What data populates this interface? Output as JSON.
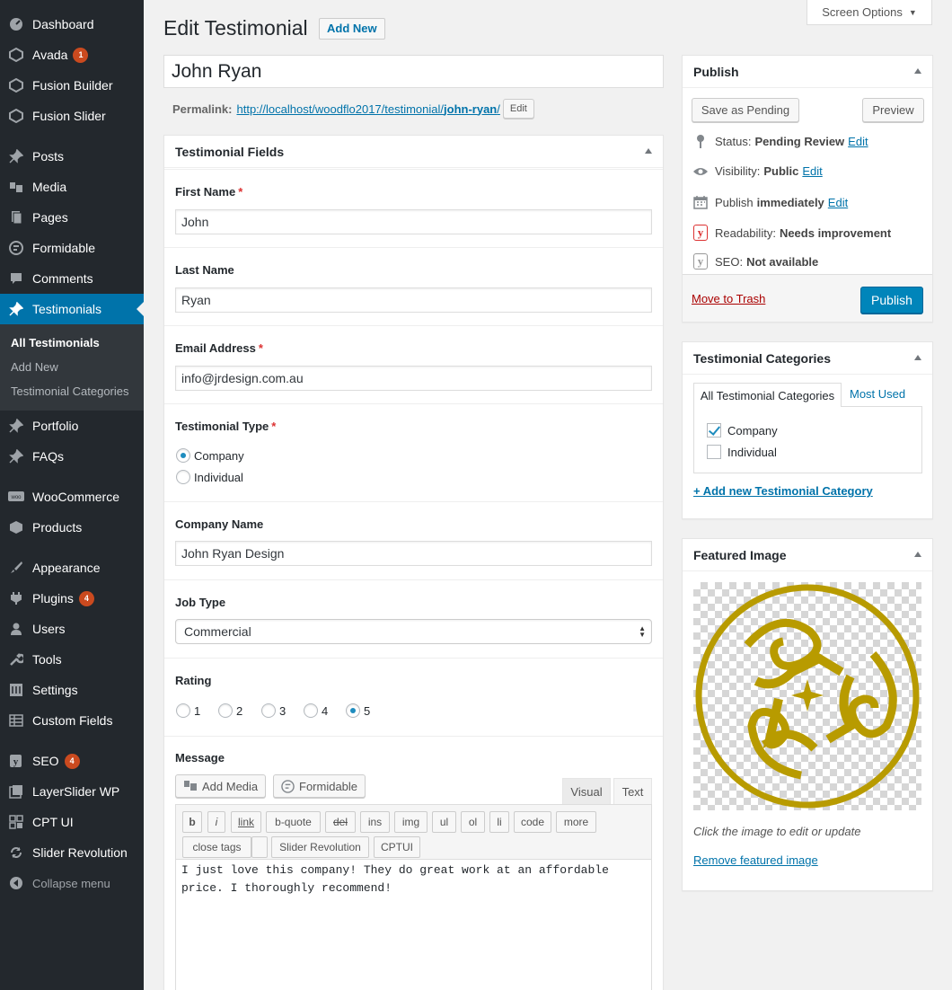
{
  "sidebar": {
    "items": [
      {
        "label": "Dashboard",
        "icon": "dashboard-icon"
      },
      {
        "label": "Avada",
        "icon": "avada-icon",
        "badge": "1"
      },
      {
        "label": "Fusion Builder",
        "icon": "fusion-builder-icon"
      },
      {
        "label": "Fusion Slider",
        "icon": "fusion-slider-icon"
      },
      {
        "label": "Posts",
        "icon": "pin-icon"
      },
      {
        "label": "Media",
        "icon": "media-icon"
      },
      {
        "label": "Pages",
        "icon": "pages-icon"
      },
      {
        "label": "Formidable",
        "icon": "formidable-icon"
      },
      {
        "label": "Comments",
        "icon": "comment-icon"
      },
      {
        "label": "Testimonials",
        "icon": "pin-icon"
      },
      {
        "label": "Portfolio",
        "icon": "pin-icon"
      },
      {
        "label": "FAQs",
        "icon": "pin-icon"
      },
      {
        "label": "WooCommerce",
        "icon": "woocommerce-icon"
      },
      {
        "label": "Products",
        "icon": "products-icon"
      },
      {
        "label": "Appearance",
        "icon": "appearance-icon"
      },
      {
        "label": "Plugins",
        "icon": "plugins-icon",
        "badge": "4"
      },
      {
        "label": "Users",
        "icon": "users-icon"
      },
      {
        "label": "Tools",
        "icon": "tools-icon"
      },
      {
        "label": "Settings",
        "icon": "settings-icon"
      },
      {
        "label": "Custom Fields",
        "icon": "custom-fields-icon"
      },
      {
        "label": "SEO",
        "icon": "yoast-icon",
        "badge": "4"
      },
      {
        "label": "LayerSlider WP",
        "icon": "layerslider-icon"
      },
      {
        "label": "CPT UI",
        "icon": "cptui-icon"
      },
      {
        "label": "Slider Revolution",
        "icon": "slider-revolution-icon"
      }
    ],
    "submenu": [
      "All Testimonials",
      "Add New",
      "Testimonial Categories"
    ],
    "collapse_label": "Collapse menu"
  },
  "header": {
    "title": "Edit Testimonial",
    "add_new": "Add New",
    "screen_options": "Screen Options"
  },
  "post": {
    "title": "John Ryan",
    "permalink_label": "Permalink:",
    "permalink_base": "http://localhost/woodflo2017/testimonial/",
    "permalink_slug": "john-ryan",
    "permalink_tail": "/",
    "edit_label": "Edit"
  },
  "fields_box": {
    "title": "Testimonial Fields",
    "first_name_label": "First Name",
    "first_name_value": "John",
    "last_name_label": "Last Name",
    "last_name_value": "Ryan",
    "email_label": "Email Address",
    "email_value": "info@jrdesign.com.au",
    "type_label": "Testimonial Type",
    "type_options": [
      "Company",
      "Individual"
    ],
    "company_label": "Company Name",
    "company_value": "John Ryan Design",
    "job_type_label": "Job Type",
    "job_type_value": "Commercial",
    "rating_label": "Rating",
    "rating_options": [
      "1",
      "2",
      "3",
      "4",
      "5"
    ],
    "rating_selected": "5",
    "required_mark": "*",
    "message_label": "Message",
    "add_media": "Add Media",
    "formidable": "Formidable",
    "tab_visual": "Visual",
    "tab_text": "Text",
    "quicktags": [
      "b",
      "i",
      "link",
      "b-quote",
      "del",
      "ins",
      "img",
      "ul",
      "ol",
      "li",
      "code",
      "more"
    ],
    "quicktags2": [
      "close tags",
      "",
      "Slider Revolution",
      "CPTUI"
    ],
    "message_value": "I just love this company! They do great work at an affordable\nprice. I thoroughly recommend!"
  },
  "publish": {
    "title": "Publish",
    "save_pending": "Save as Pending",
    "preview": "Preview",
    "status_label": "Status:",
    "status_value": "Pending Review",
    "visibility_label": "Visibility:",
    "visibility_value": "Public",
    "publish_label": "Publish",
    "publish_value": "immediately",
    "readability_label": "Readability:",
    "readability_value": "Needs improvement",
    "seo_label": "SEO:",
    "seo_value": "Not available",
    "edit": "Edit",
    "trash": "Move to Trash",
    "publish_button": "Publish"
  },
  "categories": {
    "title": "Testimonial Categories",
    "tab_all": "All Testimonial Categories",
    "tab_most_used": "Most Used",
    "items": [
      {
        "label": "Company",
        "checked": true
      },
      {
        "label": "Individual",
        "checked": false
      }
    ],
    "add_new": "+ Add new Testimonial Category"
  },
  "featured": {
    "title": "Featured Image",
    "hint": "Click the image to edit or update",
    "remove": "Remove featured image",
    "logo_color": "#b89b00"
  },
  "colors": {
    "accent": "#0073aa",
    "sidebar": "#23282d",
    "primary_button": "#0085ba",
    "badge": "#ca4a1f",
    "required": "#dc3232"
  }
}
